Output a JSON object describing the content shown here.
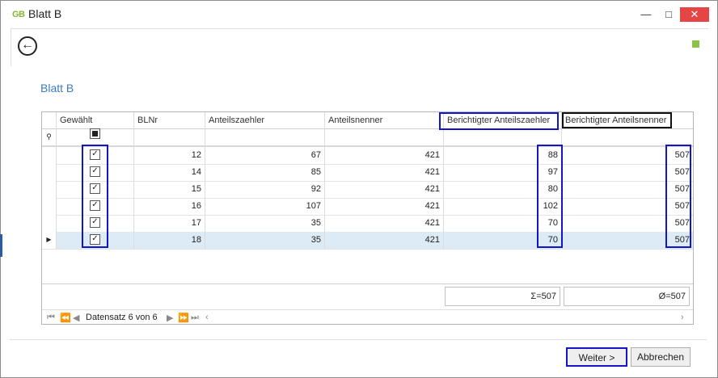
{
  "window": {
    "title": "Blatt B",
    "logo": "GB"
  },
  "page": {
    "heading": "Blatt B"
  },
  "grid": {
    "columns": [
      "Gewählt",
      "BLNr",
      "Anteilszaehler",
      "Anteilsnenner",
      "Berichtigter Anteilszaehler",
      "Berichtigter Anteilsnenner"
    ],
    "rows": [
      {
        "checked": true,
        "blnr": "12",
        "zaehler": "67",
        "nenner": "421",
        "ber_zaehler": "88",
        "ber_nenner": "507"
      },
      {
        "checked": true,
        "blnr": "14",
        "zaehler": "85",
        "nenner": "421",
        "ber_zaehler": "97",
        "ber_nenner": "507"
      },
      {
        "checked": true,
        "blnr": "15",
        "zaehler": "92",
        "nenner": "421",
        "ber_zaehler": "80",
        "ber_nenner": "507"
      },
      {
        "checked": true,
        "blnr": "16",
        "zaehler": "107",
        "nenner": "421",
        "ber_zaehler": "102",
        "ber_nenner": "507"
      },
      {
        "checked": true,
        "blnr": "17",
        "zaehler": "35",
        "nenner": "421",
        "ber_zaehler": "70",
        "ber_nenner": "507"
      },
      {
        "checked": true,
        "blnr": "18",
        "zaehler": "35",
        "nenner": "421",
        "ber_zaehler": "70",
        "ber_nenner": "507"
      }
    ],
    "footer": {
      "sum": "Σ=507",
      "avg": "Ø=507"
    },
    "navigator": {
      "record_text": "Datensatz 6 von 6"
    }
  },
  "buttons": {
    "next": "Weiter >",
    "cancel": "Abbrechen"
  },
  "colors": {
    "accent": "#3c7bbf",
    "highlight_box": "#1515c8",
    "selected_row": "#ddebf7",
    "logo": "#8bb23a",
    "close": "#e64545"
  }
}
